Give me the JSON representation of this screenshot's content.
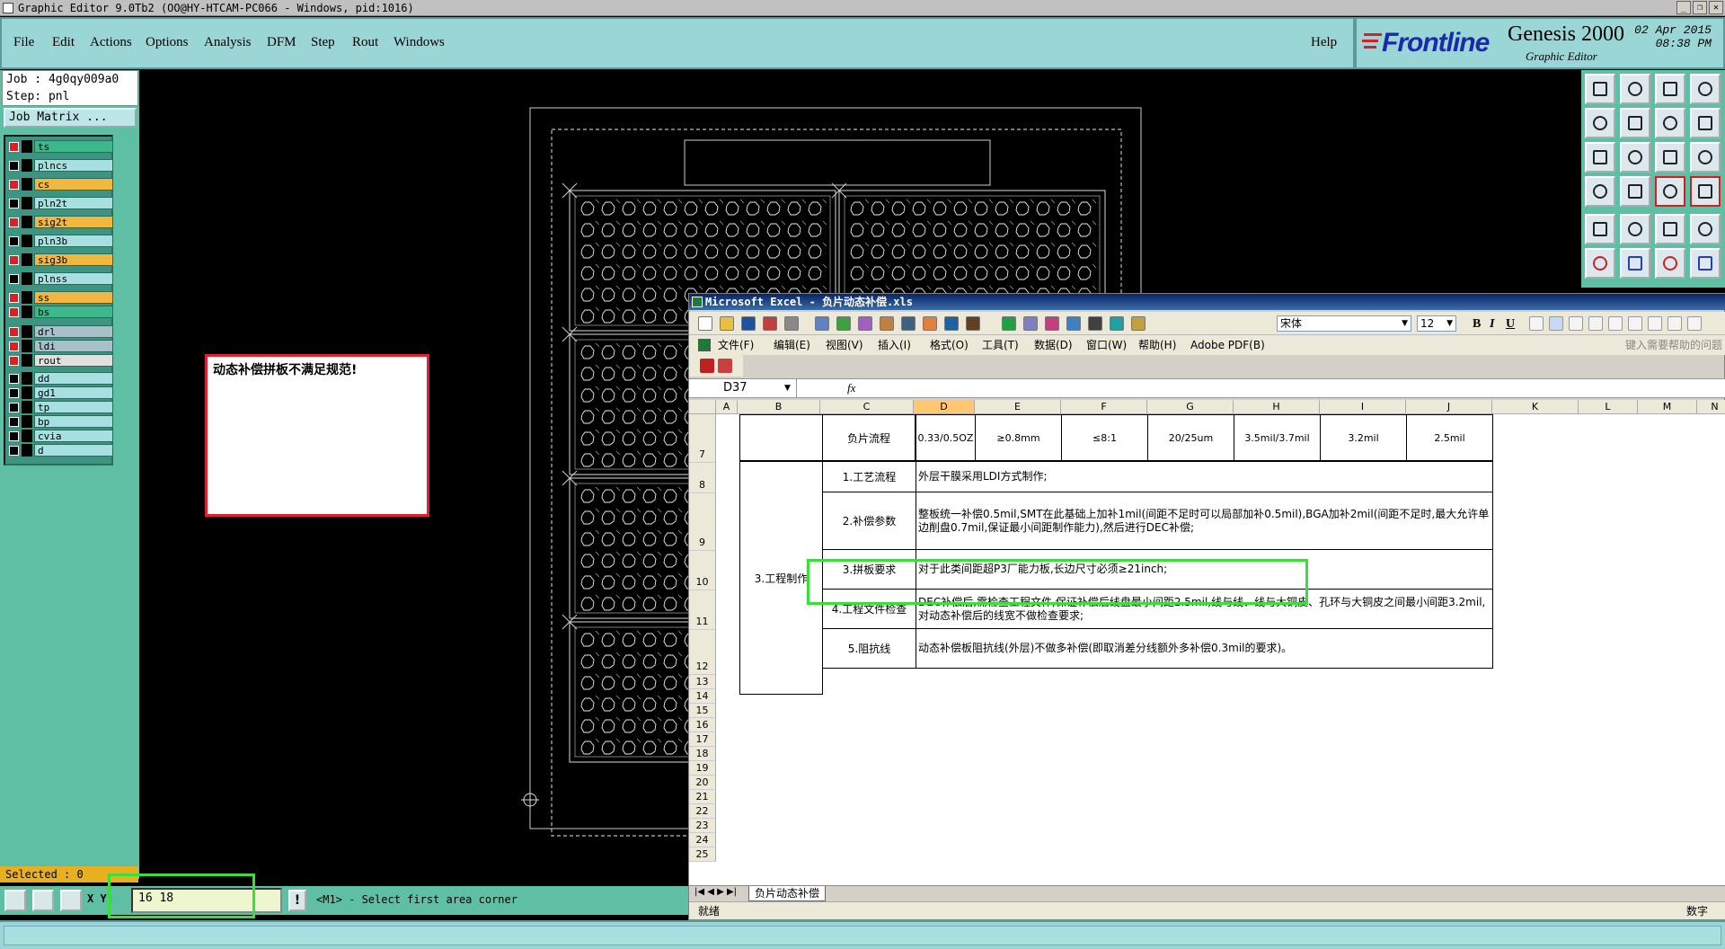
{
  "window": {
    "title": "Graphic Editor 9.0Tb2 (OO@HY-HTCAM-PC066 - Windows, pid:1016)"
  },
  "menu": [
    {
      "label": "File"
    },
    {
      "label": "Edit"
    },
    {
      "label": "Actions"
    },
    {
      "label": "Options"
    },
    {
      "label": "Analysis"
    },
    {
      "label": "DFM"
    },
    {
      "label": "Step"
    },
    {
      "label": "Rout"
    },
    {
      "label": "Windows"
    }
  ],
  "help_label": "Help",
  "brand": {
    "logo": "Frontline",
    "product": "Genesis 2000",
    "subtitle": "Graphic Editor",
    "date": "02 Apr 2015",
    "time": "08:38 PM"
  },
  "job": {
    "job_line": "Job : 4g0qy009a0",
    "step_line": "Step: pnl",
    "job_matrix": "Job Matrix ..."
  },
  "layers": [
    {
      "name": "ts",
      "color": "#3cb88a",
      "active": true
    },
    {
      "name": "plncs",
      "color": "#a8dfe0",
      "active": false
    },
    {
      "name": "cs",
      "color": "#f0b840",
      "active": true
    },
    {
      "name": "pln2t",
      "color": "#a8dfe0",
      "active": false
    },
    {
      "name": "sig2t",
      "color": "#f0b840",
      "active": true
    },
    {
      "name": "pln3b",
      "color": "#a8dfe0",
      "active": false
    },
    {
      "name": "sig3b",
      "color": "#f0b840",
      "active": true
    },
    {
      "name": "plnss",
      "color": "#a8dfe0",
      "active": false
    },
    {
      "name": "ss",
      "color": "#f0b840",
      "active": true
    },
    {
      "name": "bs",
      "color": "#3cb88a",
      "active": true
    },
    {
      "name": "drl",
      "color": "#a8c0c8",
      "active": true
    },
    {
      "name": "ldi",
      "color": "#a8c0c8",
      "active": true
    },
    {
      "name": "rout",
      "color": "#e0e0e0",
      "active": true
    },
    {
      "name": "dd",
      "color": "#a8dfe0",
      "active": false
    },
    {
      "name": "gd1",
      "color": "#a8dfe0",
      "active": false
    },
    {
      "name": "tp",
      "color": "#a8dfe0",
      "active": false
    },
    {
      "name": "bp",
      "color": "#a8dfe0",
      "active": false
    },
    {
      "name": "cvia",
      "color": "#a8dfe0",
      "active": false
    },
    {
      "name": "d",
      "color": "#a8dfe0",
      "active": false
    }
  ],
  "selected_label": "Selected : 0",
  "error_message": "动态补偿拼板不满足规范!",
  "coords": {
    "label": "X Y:",
    "value": "16 18"
  },
  "prompt": "<M1> - Select first area corner",
  "excel": {
    "title": "Microsoft Excel - 负片动态补偿.xls",
    "font": "宋体",
    "size": "12",
    "menu": [
      "文件(F)",
      "编辑(E)",
      "视图(V)",
      "插入(I)",
      "格式(O)",
      "工具(T)",
      "数据(D)",
      "窗口(W)",
      "帮助(H)",
      "Adobe PDF(B)"
    ],
    "help_placeholder": "键入需要帮助的问题",
    "name_box": "D37",
    "fx": "fx",
    "columns": [
      "A",
      "B",
      "C",
      "D",
      "E",
      "F",
      "G",
      "H",
      "I",
      "J",
      "K",
      "L",
      "M",
      "N"
    ],
    "rows": [
      "7",
      "8",
      "9",
      "10",
      "11",
      "12",
      "13",
      "14",
      "15",
      "16",
      "17",
      "18",
      "19",
      "20",
      "21",
      "22",
      "23",
      "24",
      "25"
    ],
    "row7": {
      "label": "负片流程",
      "values": [
        "0.33/0.5OZ",
        "≥0.8mm",
        "≤8:1",
        "20/25um",
        "3.5mil/3.7mil",
        "3.2mil",
        "2.5mil"
      ]
    },
    "group_label": "3.工程制作",
    "items": [
      {
        "name": "1.工艺流程",
        "text": "外层干膜采用LDI方式制作;"
      },
      {
        "name": "2.补偿参数",
        "text": "整板统一补偿0.5mil,SMT在此基础上加补1mil(间距不足时可以局部加补0.5mil),BGA加补2mil(间距不足时,最大允许单边削盘0.7mil,保证最小间距制作能力),然后进行DEC补偿;"
      },
      {
        "name": "3.拼板要求",
        "text": "对于此类间距超P3厂能力板,长边尺寸必须≥21inch;"
      },
      {
        "name": "4.工程文件检查",
        "text": "DEC补偿后,需检查工程文件,保证补偿后线盘最小间距2.5mil,线与线、线与大铜皮、孔环与大铜皮之间最小间距3.2mil,对动态补偿后的线宽不做检查要求;"
      },
      {
        "name": "5.阻抗线",
        "text": "动态补偿板阻抗线(外层)不做多补偿(即取消差分线额外多补偿0.3mil的要求)。"
      }
    ],
    "sheet_tab": "负片动态补偿",
    "status_left": "就绪",
    "status_right": "数字"
  }
}
